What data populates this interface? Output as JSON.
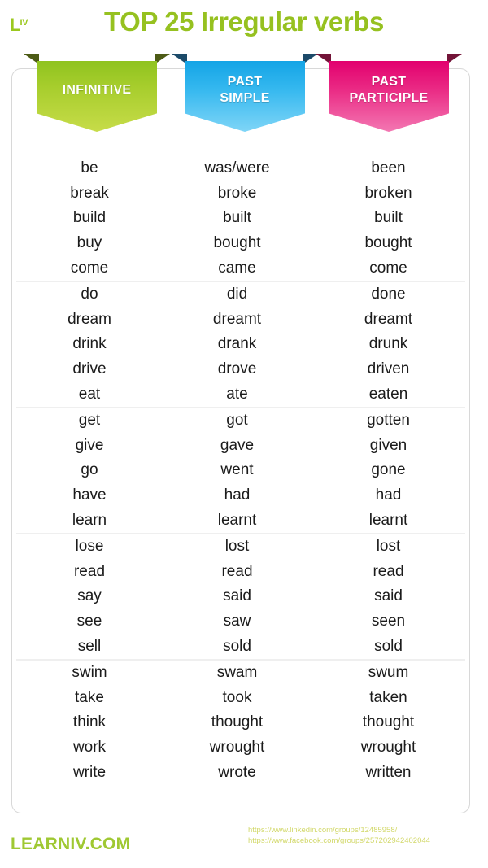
{
  "header": {
    "brand_mark_main": "L",
    "brand_mark_sup": "IV",
    "title": "TOP 25 Irregular verbs"
  },
  "columns": [
    {
      "id": "infinitive",
      "label_lines": [
        "INFINITIVE"
      ],
      "color": "#8fc31f"
    },
    {
      "id": "past_simple",
      "label_lines": [
        "PAST",
        "SIMPLE"
      ],
      "color": "#14a4e6"
    },
    {
      "id": "past_participle",
      "label_lines": [
        "PAST",
        "PARTICIPLE"
      ],
      "color": "#e2006e"
    }
  ],
  "groups": [
    {
      "rows": [
        {
          "infinitive": "be",
          "past_simple": "was/were",
          "past_participle": "been"
        },
        {
          "infinitive": "break",
          "past_simple": "broke",
          "past_participle": "broken"
        },
        {
          "infinitive": "build",
          "past_simple": "built",
          "past_participle": "built"
        },
        {
          "infinitive": "buy",
          "past_simple": "bought",
          "past_participle": "bought"
        },
        {
          "infinitive": "come",
          "past_simple": "came",
          "past_participle": "come"
        }
      ]
    },
    {
      "rows": [
        {
          "infinitive": "do",
          "past_simple": "did",
          "past_participle": "done"
        },
        {
          "infinitive": "dream",
          "past_simple": "dreamt",
          "past_participle": "dreamt"
        },
        {
          "infinitive": "drink",
          "past_simple": "drank",
          "past_participle": "drunk"
        },
        {
          "infinitive": "drive",
          "past_simple": "drove",
          "past_participle": "driven"
        },
        {
          "infinitive": "eat",
          "past_simple": "ate",
          "past_participle": "eaten"
        }
      ]
    },
    {
      "rows": [
        {
          "infinitive": "get",
          "past_simple": "got",
          "past_participle": "gotten"
        },
        {
          "infinitive": "give",
          "past_simple": "gave",
          "past_participle": "given"
        },
        {
          "infinitive": "go",
          "past_simple": "went",
          "past_participle": "gone"
        },
        {
          "infinitive": "have",
          "past_simple": "had",
          "past_participle": "had"
        },
        {
          "infinitive": "learn",
          "past_simple": "learnt",
          "past_participle": "learnt"
        }
      ]
    },
    {
      "rows": [
        {
          "infinitive": "lose",
          "past_simple": "lost",
          "past_participle": "lost"
        },
        {
          "infinitive": "read",
          "past_simple": "read",
          "past_participle": "read"
        },
        {
          "infinitive": "say",
          "past_simple": "said",
          "past_participle": "said"
        },
        {
          "infinitive": "see",
          "past_simple": "saw",
          "past_participle": "seen"
        },
        {
          "infinitive": "sell",
          "past_simple": "sold",
          "past_participle": "sold"
        }
      ]
    },
    {
      "rows": [
        {
          "infinitive": "swim",
          "past_simple": "swam",
          "past_participle": "swum"
        },
        {
          "infinitive": "take",
          "past_simple": "took",
          "past_participle": "taken"
        },
        {
          "infinitive": "think",
          "past_simple": "thought",
          "past_participle": "thought"
        },
        {
          "infinitive": "work",
          "past_simple": "wrought",
          "past_participle": "wrought"
        },
        {
          "infinitive": "write",
          "past_simple": "wrote",
          "past_participle": "written"
        }
      ]
    }
  ],
  "footer": {
    "site_logo": "LEARNIV.COM",
    "links": [
      "https://www.linkedin.com/groups/12485958/",
      "https://www.facebook.com/groups/257202942402044"
    ]
  }
}
